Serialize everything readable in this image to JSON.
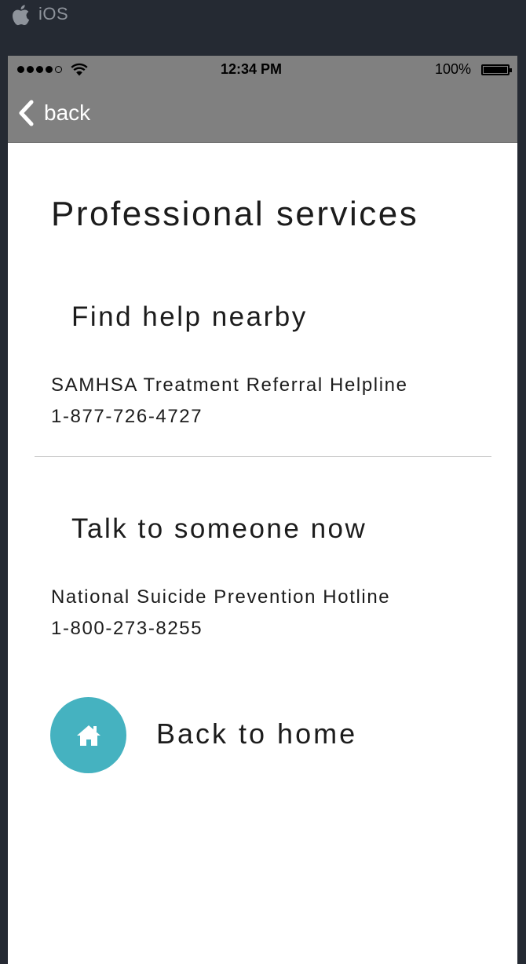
{
  "os": {
    "label": "iOS",
    "logo_icon": "apple-logo-icon"
  },
  "status_bar": {
    "time": "12:34 PM",
    "battery_percent": "100%",
    "signal_bars_filled": 4,
    "signal_bars_total": 5
  },
  "nav": {
    "back_label": "back"
  },
  "page": {
    "title": "Professional services",
    "sections": [
      {
        "heading": "Find help nearby",
        "org": "SAMHSA Treatment Referral Helpline",
        "phone": "1-877-726-4727"
      },
      {
        "heading": "Talk to someone now",
        "org": "National Suicide Prevention Hotline",
        "phone": "1-800-273-8255"
      }
    ],
    "home_button": {
      "label": "Back to home",
      "icon": "home-icon"
    }
  },
  "colors": {
    "header_bg": "#808080",
    "accent": "#45b2c0",
    "frame_bg": "#252a33"
  }
}
